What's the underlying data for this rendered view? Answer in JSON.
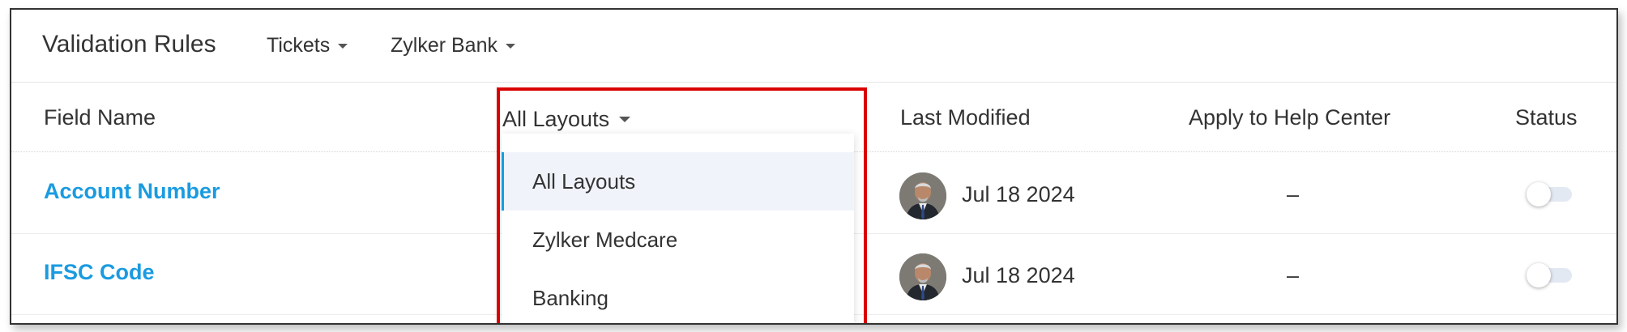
{
  "header": {
    "title": "Validation Rules",
    "module_dropdown": "Tickets",
    "department_dropdown": "Zylker Bank"
  },
  "columns": {
    "field_name": "Field Name",
    "layouts": "All Layouts",
    "last_modified": "Last Modified",
    "apply_help_center": "Apply to Help Center",
    "status": "Status"
  },
  "rows": [
    {
      "field_name": "Account Number",
      "last_modified": "Jul 18 2024",
      "apply_help_center": "–",
      "status_on": false
    },
    {
      "field_name": "IFSC Code",
      "last_modified": "Jul 18 2024",
      "apply_help_center": "–",
      "status_on": false
    }
  ],
  "layout_menu": {
    "selected": "All Layouts",
    "items": [
      "All Layouts",
      "Zylker Medcare",
      "Banking"
    ]
  },
  "colors": {
    "link": "#1a9be0",
    "highlight": "#d90000",
    "selected_item_bg": "#f0f4fa"
  }
}
